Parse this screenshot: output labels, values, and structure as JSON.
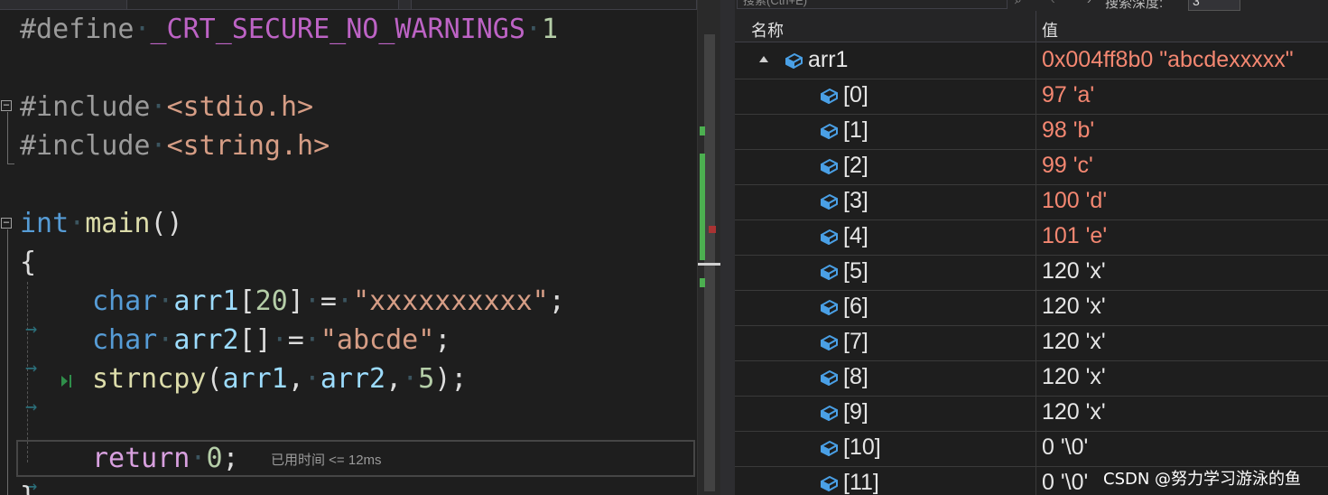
{
  "editor": {
    "lines": {
      "define": {
        "directive": "#define",
        "macro": "_CRT_SECURE_NO_WARNINGS",
        "value": "1"
      },
      "include1": {
        "directive": "#include",
        "header": "<stdio.h>"
      },
      "include2": {
        "directive": "#include",
        "header": "<string.h>"
      },
      "main_sig": {
        "type": "int",
        "name": "main",
        "parens": "()"
      },
      "open_brace": "{",
      "decl1": {
        "type": "char",
        "name": "arr1",
        "open": "[",
        "size": "20",
        "close": "]",
        "assign": "=",
        "literal": "\"xxxxxxxxxx\"",
        "semi": ";"
      },
      "decl2": {
        "type": "char",
        "name": "arr2",
        "brackets": "[]",
        "assign": "=",
        "literal": "\"abcde\"",
        "semi": ";"
      },
      "call": {
        "func": "strncpy",
        "open": "(",
        "arg1": "arr1",
        "comma1": ",",
        "arg2": "arr2",
        "comma2": ",",
        "arg3": "5",
        "close": ");"
      },
      "ret": {
        "keyword": "return",
        "value": "0",
        "semi": ";"
      },
      "close_brace": "}"
    },
    "perf_tip": "已用时间 <= 12ms"
  },
  "watch": {
    "search_placeholder": "搜索(Ctrl+E)",
    "search_depth_label": "搜索深度:",
    "search_depth_value": "3",
    "columns": {
      "name": "名称",
      "value": "值"
    },
    "root": {
      "name": "arr1",
      "value": "0x004ff8b0 \"abcdexxxxx\"",
      "expanded": true
    },
    "items": [
      {
        "name": "[0]",
        "value": "97 'a'",
        "changed": true
      },
      {
        "name": "[1]",
        "value": "98 'b'",
        "changed": true
      },
      {
        "name": "[2]",
        "value": "99 'c'",
        "changed": true
      },
      {
        "name": "[3]",
        "value": "100 'd'",
        "changed": true
      },
      {
        "name": "[4]",
        "value": "101 'e'",
        "changed": true
      },
      {
        "name": "[5]",
        "value": "120 'x'",
        "changed": false
      },
      {
        "name": "[6]",
        "value": "120 'x'",
        "changed": false
      },
      {
        "name": "[7]",
        "value": "120 'x'",
        "changed": false
      },
      {
        "name": "[8]",
        "value": "120 'x'",
        "changed": false
      },
      {
        "name": "[9]",
        "value": "120 'x'",
        "changed": false
      },
      {
        "name": "[10]",
        "value": "0 '\\0'",
        "changed": false
      },
      {
        "name": "[11]",
        "value": "0 '\\0'",
        "changed": false
      }
    ],
    "icon": "variable-field-icon"
  },
  "colors": {
    "changed_value": "#f48771",
    "keyword": "#569cd6",
    "string": "#d69d85",
    "function": "#dcdcaa",
    "variable": "#9cdcfe",
    "number": "#b5cea8",
    "diff_marker": "#4caf50"
  },
  "watermark": "CSDN @努力学习游泳的鱼"
}
